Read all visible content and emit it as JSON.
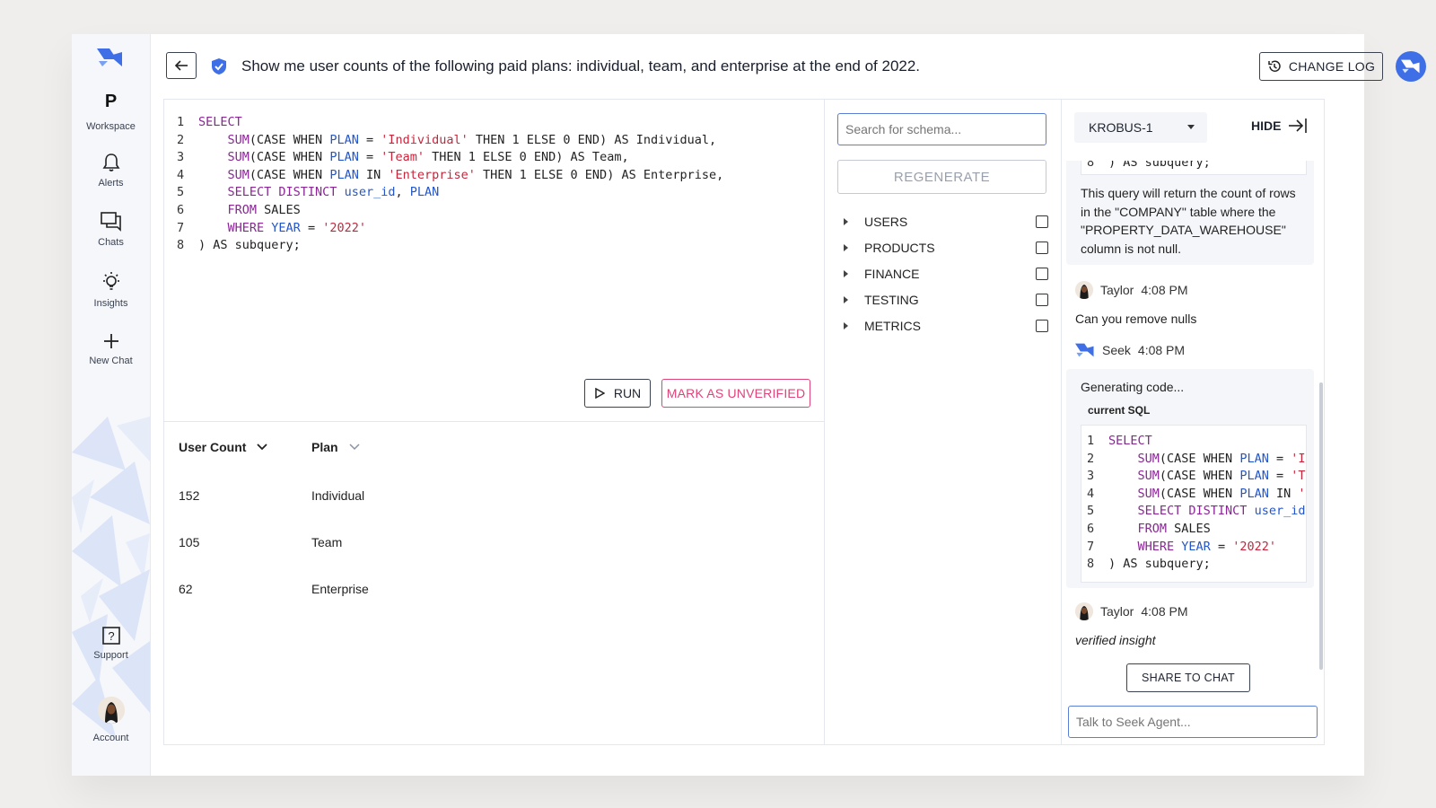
{
  "sidebar": {
    "workspace_letter": "P",
    "items": [
      {
        "label": "Workspace"
      },
      {
        "label": "Alerts"
      },
      {
        "label": "Chats"
      },
      {
        "label": "Insights"
      },
      {
        "label": "New Chat"
      },
      {
        "label": "Support"
      },
      {
        "label": "Account"
      }
    ]
  },
  "header": {
    "question": "Show me user counts of the following paid plans: individual, team, and enterprise at the end of 2022.",
    "changelog_label": "CHANGE LOG"
  },
  "editor": {
    "lines": [
      "1",
      "2",
      "3",
      "4",
      "5",
      "6",
      "7",
      "8"
    ],
    "run_label": "RUN",
    "unverify_label": "MARK AS UNVERIFIED"
  },
  "results": {
    "columns": [
      "User Count",
      "Plan"
    ],
    "rows": [
      [
        "152",
        "Individual"
      ],
      [
        "105",
        "Team"
      ],
      [
        "62",
        "Enterprise"
      ]
    ]
  },
  "schema": {
    "search_placeholder": "Search for schema...",
    "regenerate_label": "REGENERATE",
    "tables": [
      "USERS",
      "PRODUCTS",
      "FINANCE",
      "TESTING",
      "METRICS"
    ]
  },
  "chat": {
    "model": "KROBUS-1",
    "hide_label": "HIDE",
    "prev_code_tail": ") AS subquery;",
    "assistant_reply": "This query will return the count of rows in the \"COMPANY\" table where the \"PROPERTY_DATA_WAREHOUSE\" column is not null.",
    "messages": [
      {
        "author": "Taylor",
        "time": "4:08 PM",
        "text": "Can you remove nulls"
      },
      {
        "author": "Seek",
        "time": "4:08 PM",
        "text": "Generating code..."
      },
      {
        "author": "Taylor",
        "time": "4:08 PM",
        "text": "verified insight"
      }
    ],
    "current_sql_label": "current SQL",
    "share_label": "SHARE TO CHAT",
    "input_placeholder": "Talk to Seek Agent..."
  },
  "colors": {
    "accent": "#3f6fe6",
    "danger": "#e0427a",
    "keyword": "#8a2596",
    "identifier": "#2456c9",
    "string": "#c5263c"
  }
}
